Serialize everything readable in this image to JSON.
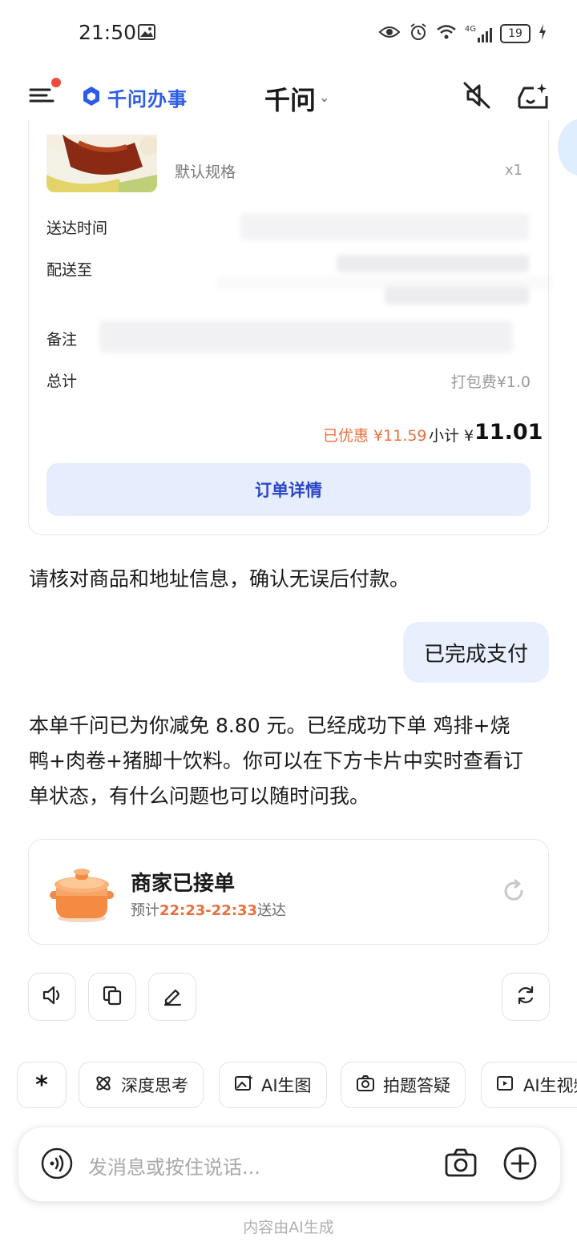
{
  "status_bar": {
    "time": "21:50",
    "network": "4G",
    "battery": "19"
  },
  "header": {
    "brand": "千问办事",
    "title": "千问"
  },
  "order": {
    "spec": "默认规格",
    "qty": "x1",
    "labels": {
      "delivery_time": "送达时间",
      "deliver_to": "配送至",
      "note": "备注",
      "total": "总计"
    },
    "pack_fee": "打包费¥1.0",
    "discount": "已优惠 ¥11.59",
    "subtotal_label": "小计 ¥",
    "subtotal_value": "11.01",
    "detail_button": "订单详情"
  },
  "messages": {
    "assistant_1": "请核对商品和地址信息，确认无误后付款。",
    "user_1": "已完成支付",
    "assistant_2_line1": "本单千问已为你减免 8.80 元。已经成功下单 鸡排+烧",
    "assistant_2_line2": "鸭+肉卷+猪脚十饮料。你可以在下方卡片中实时查看订",
    "assistant_2_line3": "单状态，有什么问题也可以随时问我。"
  },
  "order_status": {
    "title": "商家已接单",
    "eta_prefix": "预计",
    "eta_time": "22:23-22:33",
    "eta_suffix": "送达"
  },
  "chips": [
    "深度思考",
    "AI生图",
    "拍题答疑",
    "AI生视频"
  ],
  "input": {
    "placeholder": "发消息或按住说话..."
  },
  "footer": "内容由AI生成",
  "colors": {
    "brand_blue": "#2c5ce6",
    "accent_orange": "#e8703f",
    "bubble_blue": "#e8f0fd"
  }
}
